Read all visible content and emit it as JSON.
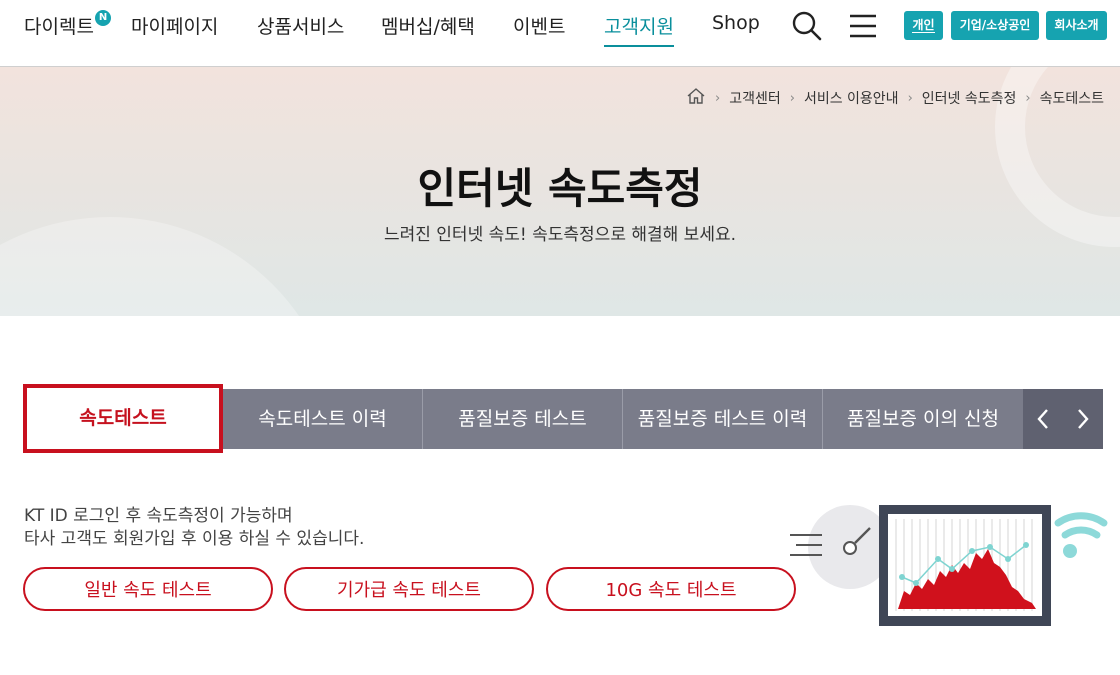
{
  "header": {
    "logo_text": "다이렉트",
    "logo_badge": "N",
    "nav": [
      {
        "label": "마이페이지"
      },
      {
        "label": "상품서비스"
      },
      {
        "label": "멤버십/혜택"
      },
      {
        "label": "이벤트"
      },
      {
        "label": "고객지원"
      },
      {
        "label": "Shop"
      }
    ],
    "active_nav": "고객지원",
    "pills": {
      "personal": "개인",
      "business": "기업/소상공인",
      "company": "회사소개"
    },
    "icons": {
      "search": "search-icon",
      "menu": "hamburger-menu-icon"
    }
  },
  "breadcrumb": {
    "home_icon": "home-icon",
    "items": [
      "고객센터",
      "서비스 이용안내",
      "인터넷 속도측정",
      "속도테스트"
    ]
  },
  "hero": {
    "title": "인터넷 속도측정",
    "subtitle": "느려진 인터넷 속도! 속도측정으로 해결해 보세요."
  },
  "tabs": {
    "items": [
      "속도테스트",
      "속도테스트 이력",
      "품질보증 테스트",
      "품질보증 테스트 이력",
      "품질보증 이의 신청"
    ],
    "active": "속도테스트",
    "prev_icon": "chevron-left-icon",
    "next_icon": "chevron-right-icon"
  },
  "content": {
    "line1": "KT ID 로그인 후 속도측정이 가능하며",
    "line2": "타사 고객도 회원가입 후 이용 하실 수 있습니다.",
    "buttons": [
      "일반 속도 테스트",
      "기가급 속도 테스트",
      "10G 속도 테스트"
    ]
  },
  "colors": {
    "accent": "#16a3b0",
    "active_red": "#c8101e",
    "tab_bg": "#7a7c8a"
  }
}
